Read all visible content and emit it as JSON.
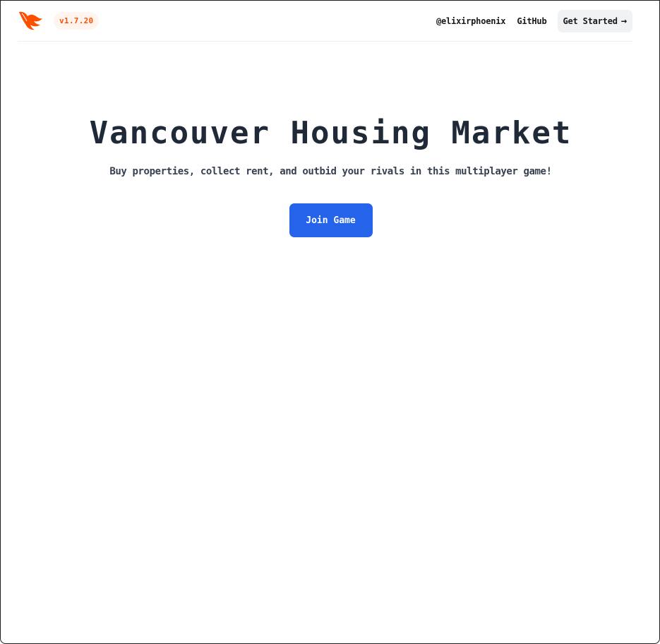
{
  "header": {
    "logo_icon": "phoenix-logo-icon",
    "version": "v1.7.20",
    "nav": {
      "twitter_label": "@elixirphoenix",
      "github_label": "GitHub",
      "get_started_label": "Get Started",
      "get_started_arrow": "→"
    }
  },
  "hero": {
    "title": "Vancouver Housing Market",
    "subtitle": "Buy properties, collect rent, and outbid your rivals in this multiplayer game!",
    "join_button_label": "Join Game"
  },
  "colors": {
    "brand_orange": "#fd4f00",
    "primary_button": "#2563eb",
    "title_text": "#1f2937"
  }
}
